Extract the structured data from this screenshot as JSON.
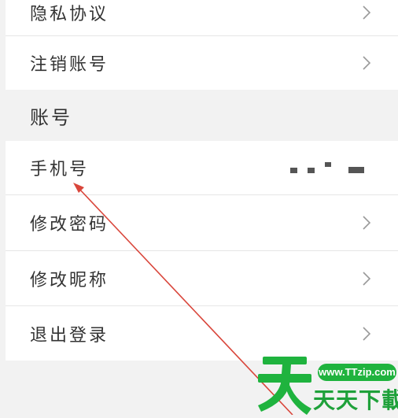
{
  "settings": {
    "items_top": [
      {
        "label": "隐私协议",
        "icon": "chevron-right-icon"
      },
      {
        "label": "注销账号",
        "icon": "chevron-right-icon"
      }
    ],
    "account_section": {
      "header": "账号",
      "phone": {
        "label": "手机号",
        "value_masked": true
      },
      "change_password": {
        "label": "修改密码",
        "icon": "chevron-right-icon"
      },
      "change_nickname": {
        "label": "修改昵称",
        "icon": "chevron-right-icon"
      },
      "logout": {
        "label": "退出登录",
        "icon": "chevron-right-icon"
      }
    }
  },
  "watermark": {
    "url": "www.TTzip.com",
    "name": "天天下載"
  },
  "colors": {
    "background": "#f2f2f2",
    "row": "#ffffff",
    "text": "#333333",
    "chevron": "#999999",
    "annotation_arrow": "#d9463b",
    "watermark_green": "#1fb33e"
  }
}
